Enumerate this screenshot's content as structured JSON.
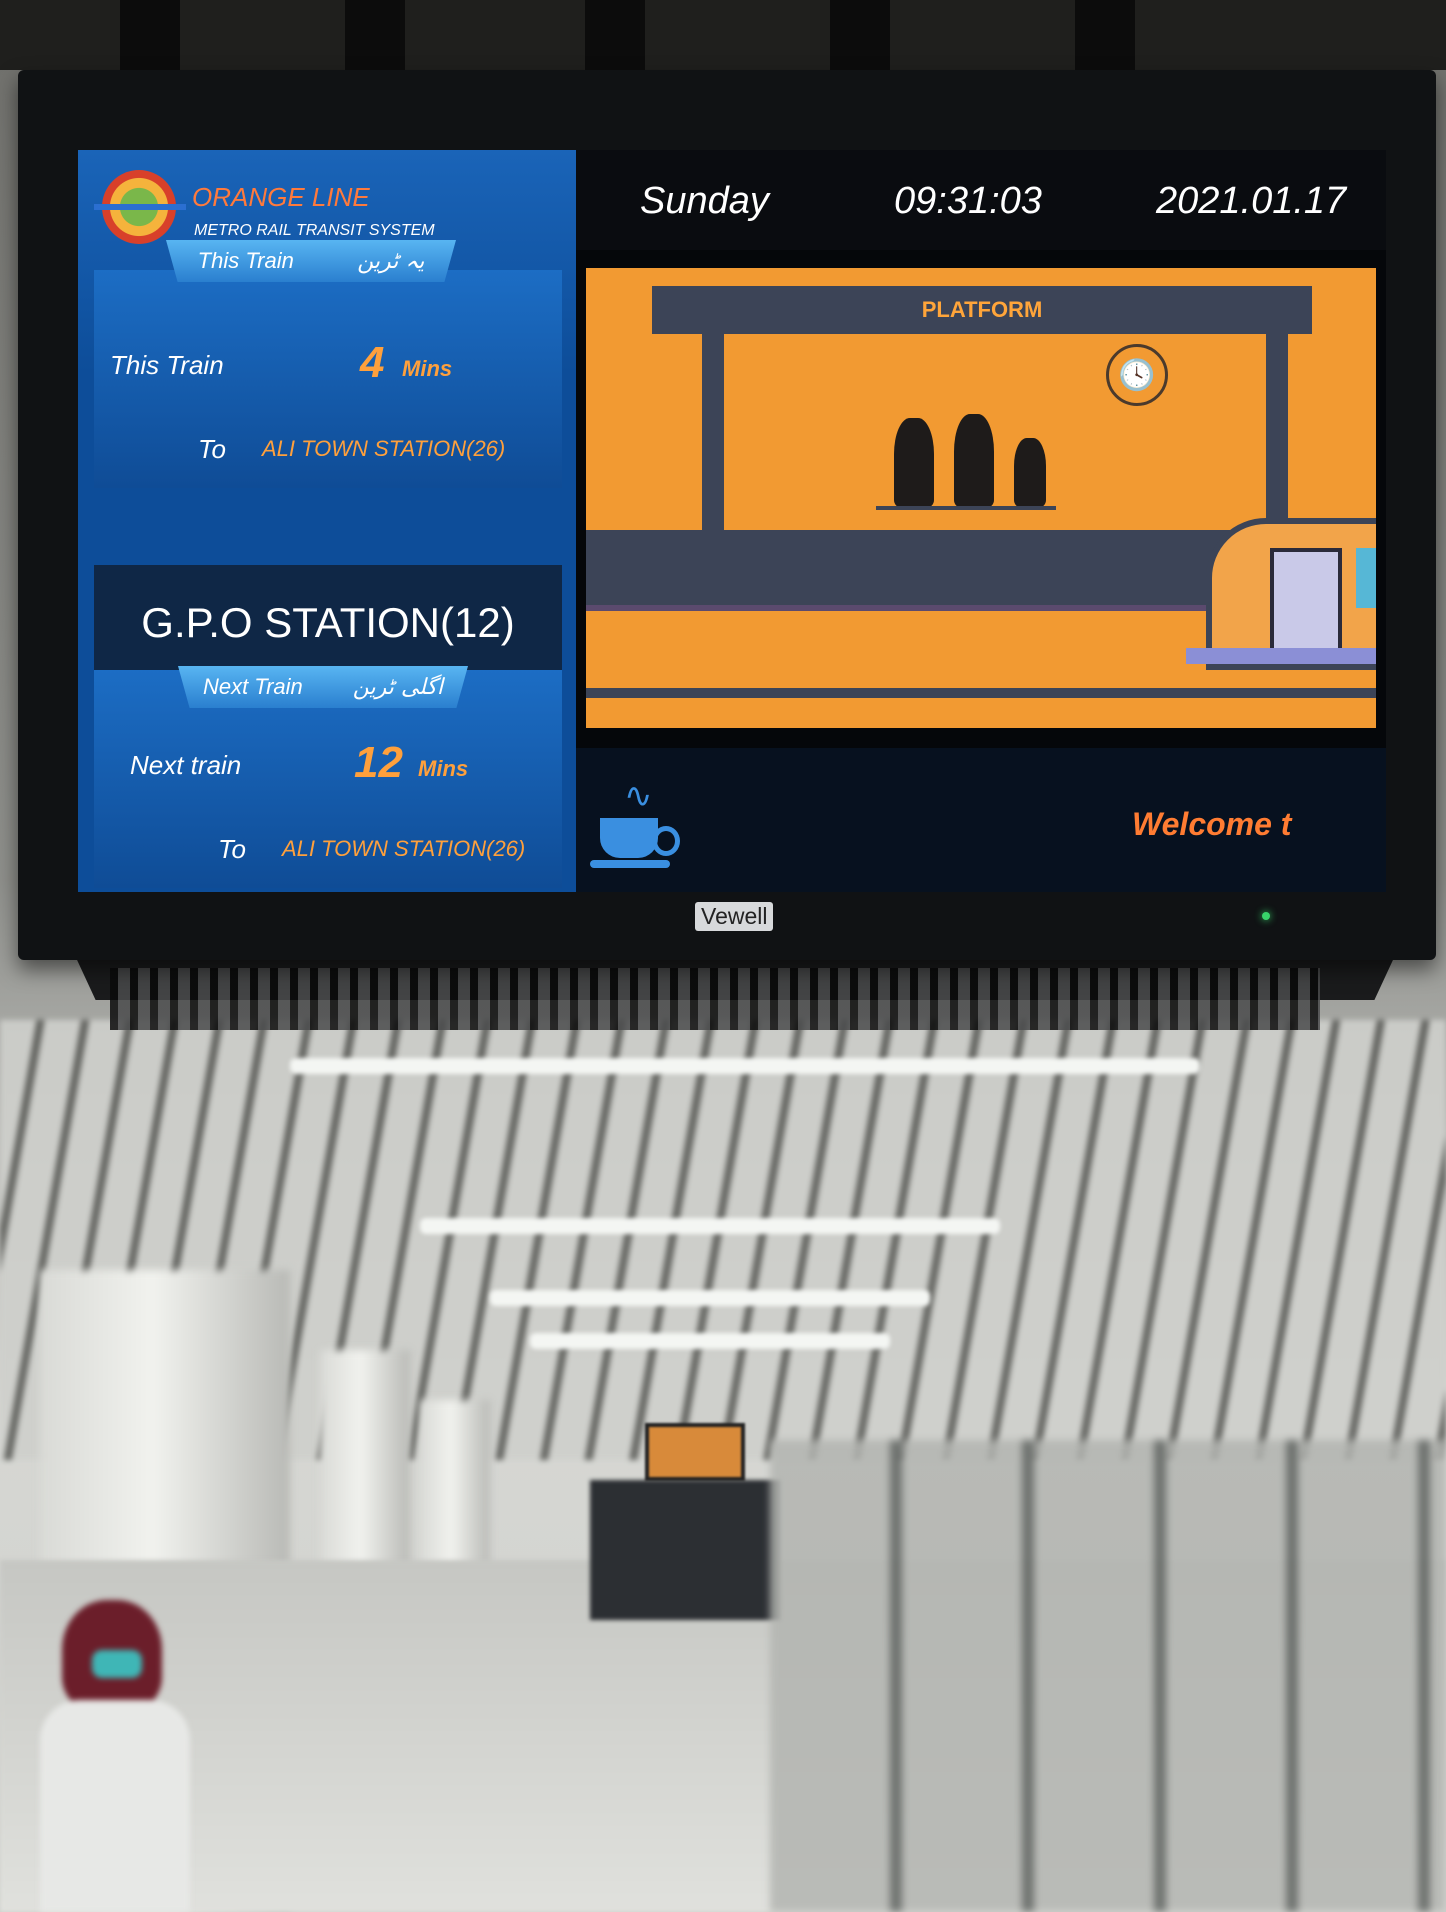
{
  "header": {
    "brand_title": "ORANGE LINE",
    "brand_subtitle": "METRO RAIL TRANSIT SYSTEM",
    "logo_icon": "metro-logo-icon"
  },
  "this_train": {
    "ribbon_en": "This Train",
    "ribbon_ur": "یہ ٹرین",
    "label": "This Train",
    "minutes": "4",
    "unit": "Mins",
    "to_label": "To",
    "destination": "ALI TOWN STATION(26)"
  },
  "current_station": "G.P.O STATION(12)",
  "next_train": {
    "ribbon_en": "Next Train",
    "ribbon_ur": "اگلی ٹرین",
    "label": "Next train",
    "minutes": "12",
    "unit": "Mins",
    "to_label": "To",
    "destination": "ALI TOWN STATION(26)"
  },
  "clock": {
    "day": "Sunday",
    "time": "09:31:03",
    "date": "2021.01.17"
  },
  "illustration": {
    "platform_label": "PLATFORM",
    "clock_icon": "wall-clock-icon",
    "train_icon": "metro-train-icon"
  },
  "ticker": {
    "text": "Welcome t",
    "icon": "coffee-cup-icon"
  },
  "monitor": {
    "brand": "Vewell"
  },
  "colors": {
    "accent_orange": "#ffa03c",
    "panel_blue": "#0d4d99",
    "platform_orange": "#f29a32"
  }
}
